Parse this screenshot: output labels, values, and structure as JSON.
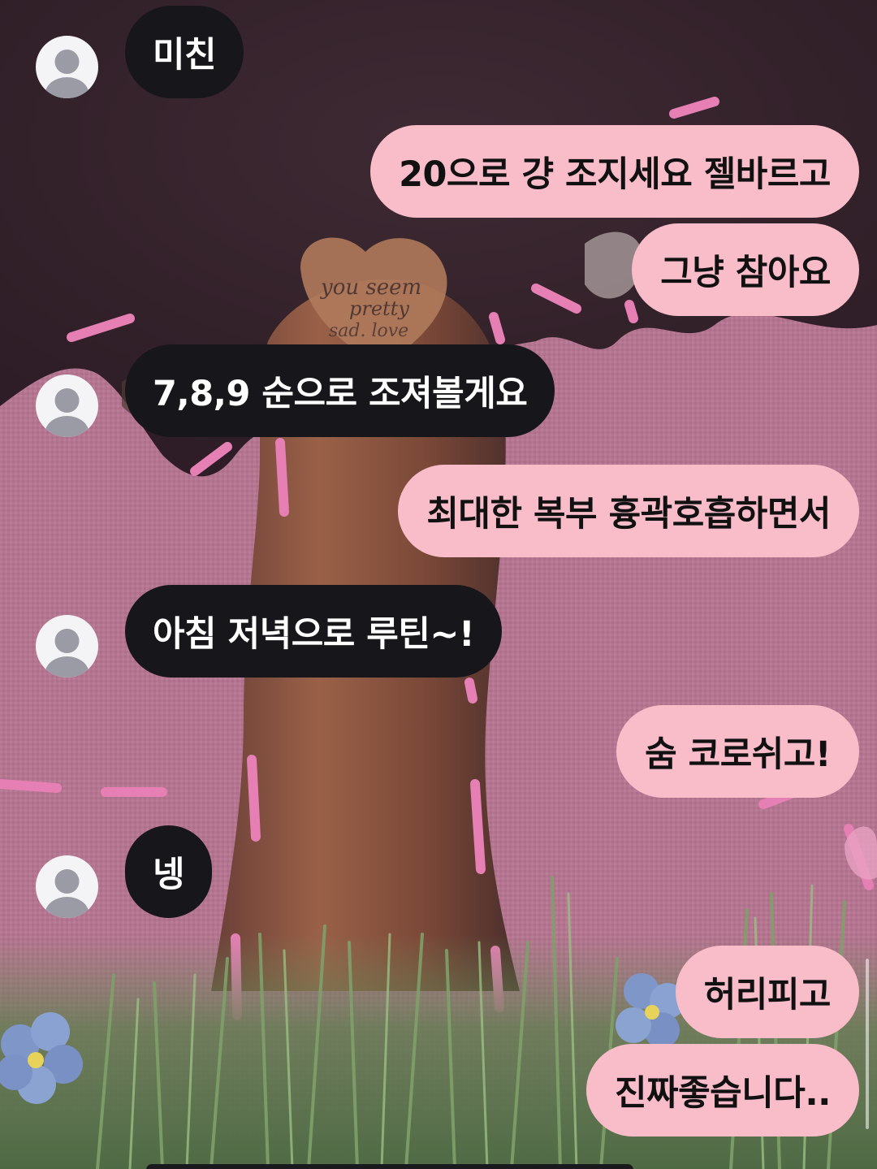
{
  "theme": {
    "incoming_bubble": "#17161a",
    "outgoing_bubble": "#f9bcc9",
    "wallpaper_fabric": "#b8768f",
    "wallpaper_dark": "#3a2430"
  },
  "wallpaper": {
    "description_icon": "embroidered-tree-wallpaper",
    "stitched_text_1": "you seem",
    "stitched_text_2": "pretty",
    "stitched_text_3": "sad. love"
  },
  "messages": [
    {
      "side": "in",
      "text": "미친"
    },
    {
      "side": "out",
      "text": "20으로 걍 조지세요 젤바르고"
    },
    {
      "side": "out",
      "text": "그냥 참아요"
    },
    {
      "side": "in",
      "text": "7,8,9 순으로 조져볼게요"
    },
    {
      "side": "out",
      "text": "최대한 복부 흉곽호흡하면서"
    },
    {
      "side": "in",
      "text": "아침 저녁으로 루틴~!"
    },
    {
      "side": "out",
      "text": "숨 코로쉬고!"
    },
    {
      "side": "in",
      "text": "넹"
    },
    {
      "side": "out",
      "text": "허리피고"
    },
    {
      "side": "out",
      "text": "진짜좋습니다.."
    }
  ]
}
